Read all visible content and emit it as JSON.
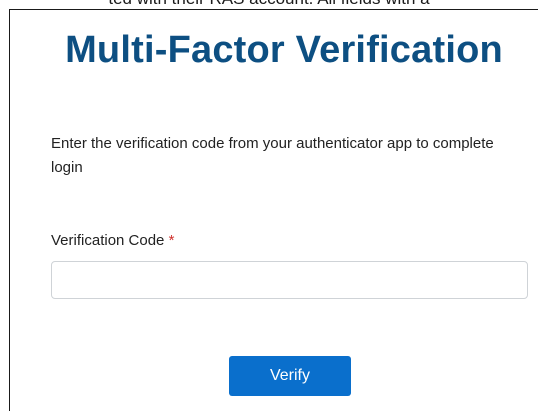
{
  "header_fragment": "ted with their RAS account. All fields with a",
  "card": {
    "title": "Multi-Factor Verification",
    "description": "Enter the verification code from your authenticator app to complete login",
    "field": {
      "label": "Verification Code",
      "required_mark": "*",
      "value": "",
      "placeholder": ""
    },
    "verify_label": "Verify"
  },
  "colors": {
    "title": "#0d4f82",
    "button": "#0a6fcc",
    "required": "#d0312d"
  }
}
